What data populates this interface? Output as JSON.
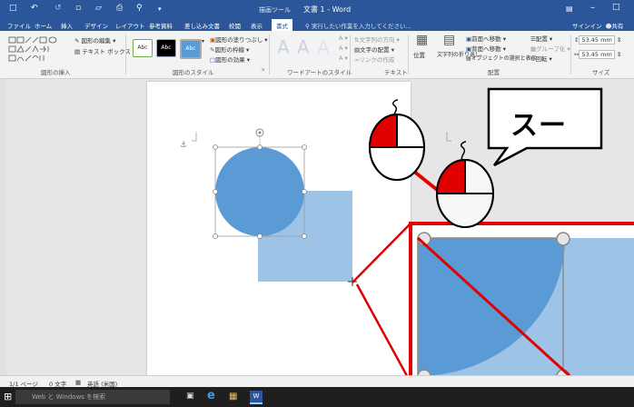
{
  "app": {
    "doc_title": "文書 1 - Word",
    "context_tab_label": "描画ツール",
    "tell_me_placeholder": "実行したい作業を入力してください...",
    "sign_in": "サインイン",
    "share": "共有"
  },
  "tabs": [
    "ファイル",
    "ホーム",
    "挿入",
    "デザイン",
    "レイアウト",
    "参考資料",
    "差し込み文書",
    "校閲",
    "表示",
    "書式"
  ],
  "active_tab": "書式",
  "ribbon": {
    "groups": [
      "図形の挿入",
      "図形のスタイル",
      "ワードアートのスタイル",
      "テキスト",
      "配置",
      "サイズ"
    ],
    "insert_shapes": {
      "edit_shape": "図形の編集",
      "text_box": "テキスト ボックス"
    },
    "shape_styles": {
      "style_label": "Abc",
      "fill": "図形の塗りつぶし",
      "outline": "図形の枠線",
      "effects": "図形の効果"
    },
    "text": {
      "direction": "文字列の方向",
      "align": "文字の配置",
      "link": "リンクの作成"
    },
    "arrange": {
      "position": "位置",
      "wrap": "文字列の折り返し",
      "bring_forward": "前面へ移動",
      "send_backward": "背面へ移動",
      "selection_pane": "オブジェクトの選択と表示",
      "align": "配置",
      "group": "グループ化",
      "rotate": "回転"
    },
    "size": {
      "height": "53.45 mm",
      "width": "53.45 mm"
    }
  },
  "status": {
    "page": "1/1 ページ",
    "words": "0 文字",
    "language": "英語 (米国)"
  },
  "taskbar": {
    "search_placeholder": "Web と Windows を検索"
  },
  "annotation": {
    "speech_text": "スー"
  },
  "colors": {
    "word_blue": "#2b579a",
    "circle_fill": "#5b9bd5",
    "square_fill": "#9dc3e6",
    "callout_red": "#e00000"
  }
}
